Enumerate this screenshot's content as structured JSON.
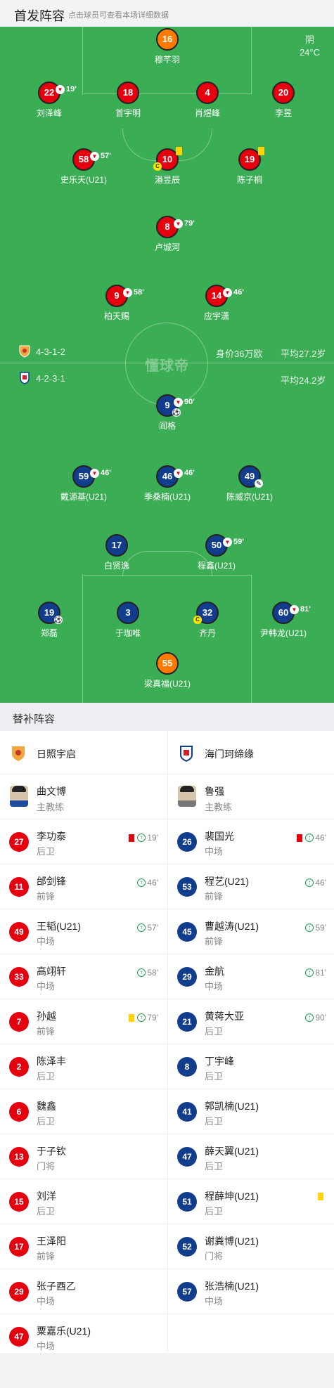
{
  "header": {
    "title": "首发阵容",
    "subtitle": "点击球员可查看本场详细数据"
  },
  "weather": {
    "condition": "阴",
    "temperature": "24°C"
  },
  "home_team": {
    "name": "日照宇启",
    "formation": "4-3-1-2",
    "value": "身价36万欧",
    "avg_age": "平均27.2岁",
    "color": "#e4000e"
  },
  "away_team": {
    "name": "海门珂缔缘",
    "formation": "4-2-3-1",
    "avg_age": "平均24.2岁",
    "color": "#123d8c"
  },
  "watermark": "懂球帝",
  "pitch_players": [
    {
      "num": "16",
      "name": "穆芊羽",
      "team": "gk_home"
    },
    {
      "num": "22",
      "name": "刘泽峰",
      "sub": "19'"
    },
    {
      "num": "18",
      "name": "首宇明"
    },
    {
      "num": "4",
      "name": "肖煜峰"
    },
    {
      "num": "20",
      "name": "李昱"
    },
    {
      "num": "58",
      "name": "史乐天(U21)",
      "sub": "57'"
    },
    {
      "num": "10",
      "name": "潘昱辰",
      "captain": "C",
      "yellow": true
    },
    {
      "num": "19",
      "name": "陈子桐",
      "yellow": true
    },
    {
      "num": "8",
      "name": "卢城河",
      "sub": "79'"
    },
    {
      "num": "9",
      "name": "柏天赐",
      "sub": "58'"
    },
    {
      "num": "14",
      "name": "应宇潇",
      "sub": "46'"
    },
    {
      "num": "9",
      "name": "阎格",
      "sub": "90'",
      "goal": true
    },
    {
      "num": "59",
      "name": "戴源基(U21)",
      "sub": "46'"
    },
    {
      "num": "46",
      "name": "季桑楠(U21)",
      "sub": "46'"
    },
    {
      "num": "49",
      "name": "陈威京(U21)",
      "other": true
    },
    {
      "num": "17",
      "name": "白贤逸"
    },
    {
      "num": "50",
      "name": "程鑫(U21)",
      "sub": "59'"
    },
    {
      "num": "19",
      "name": "郑磊",
      "goal": true
    },
    {
      "num": "3",
      "name": "于珈唯"
    },
    {
      "num": "32",
      "name": "齐丹",
      "captain": "C"
    },
    {
      "num": "60",
      "name": "尹韩龙(U21)",
      "sub": "81'"
    },
    {
      "num": "55",
      "name": "梁真福(U21)",
      "team": "gk_away"
    }
  ],
  "bench": {
    "title": "替补阵容",
    "home": {
      "team": "日照宇启",
      "coach": {
        "name": "曲文博",
        "role": "主教练"
      },
      "players": [
        {
          "num": "27",
          "name": "李功泰",
          "pos": "后卫",
          "red": true,
          "in": "19'"
        },
        {
          "num": "11",
          "name": "邰剑锋",
          "pos": "前锋",
          "in": "46'"
        },
        {
          "num": "49",
          "name": "王韬(U21)",
          "pos": "中场",
          "in": "57'"
        },
        {
          "num": "33",
          "name": "高翊轩",
          "pos": "中场",
          "in": "58'"
        },
        {
          "num": "7",
          "name": "孙越",
          "pos": "前锋",
          "yellow": true,
          "in": "79'"
        },
        {
          "num": "2",
          "name": "陈泽丰",
          "pos": "后卫"
        },
        {
          "num": "6",
          "name": "魏鑫",
          "pos": "后卫"
        },
        {
          "num": "13",
          "name": "于子钦",
          "pos": "门将"
        },
        {
          "num": "15",
          "name": "刘洋",
          "pos": "后卫"
        },
        {
          "num": "17",
          "name": "王泽阳",
          "pos": "前锋"
        },
        {
          "num": "29",
          "name": "张子酉乙",
          "pos": "中场"
        },
        {
          "num": "47",
          "name": "粟嘉乐(U21)",
          "pos": "中场"
        }
      ]
    },
    "away": {
      "team": "海门珂缔缘",
      "coach": {
        "name": "鲁强",
        "role": "主教练"
      },
      "players": [
        {
          "num": "26",
          "name": "裴国光",
          "pos": "中场",
          "red": true,
          "in": "46'"
        },
        {
          "num": "53",
          "name": "程艺(U21)",
          "pos": "前锋",
          "in": "46'"
        },
        {
          "num": "45",
          "name": "曹越涛(U21)",
          "pos": "前锋",
          "in": "59'"
        },
        {
          "num": "29",
          "name": "金航",
          "pos": "中场",
          "in": "81'"
        },
        {
          "num": "21",
          "name": "黄蒋大亚",
          "pos": "后卫",
          "in": "90'"
        },
        {
          "num": "8",
          "name": "丁宇峰",
          "pos": "后卫"
        },
        {
          "num": "41",
          "name": "郭凯楠(U21)",
          "pos": "后卫"
        },
        {
          "num": "47",
          "name": "薛天翼(U21)",
          "pos": "后卫"
        },
        {
          "num": "51",
          "name": "程薛坤(U21)",
          "pos": "后卫",
          "yellow": true
        },
        {
          "num": "52",
          "name": "谢粪博(U21)",
          "pos": "门将"
        },
        {
          "num": "57",
          "name": "张浩楠(U21)",
          "pos": "中场"
        }
      ]
    }
  }
}
